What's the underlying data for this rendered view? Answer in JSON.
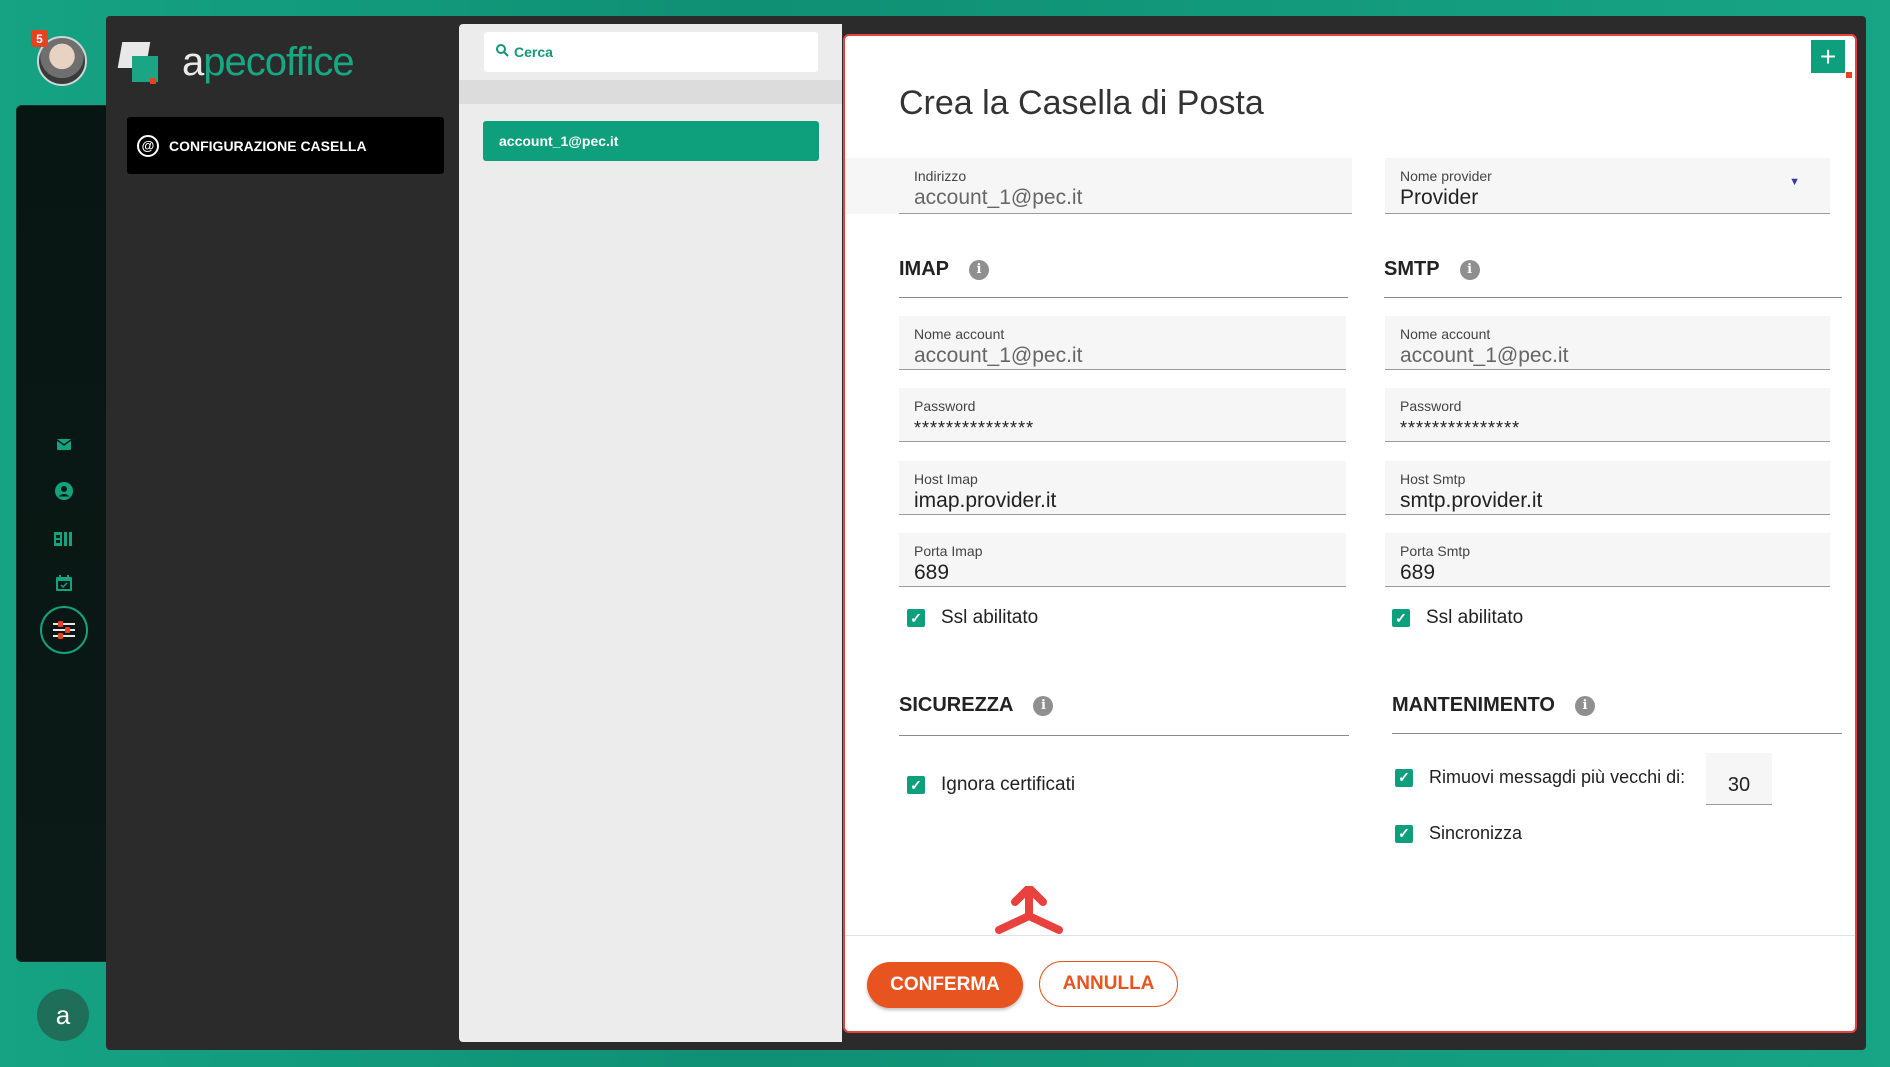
{
  "rail": {
    "badge_count": "5",
    "icons": [
      "mail-icon",
      "account-icon",
      "contacts-icon",
      "calendar-icon",
      "settings-sliders-icon"
    ],
    "bottom_logo": "a"
  },
  "brand": {
    "prefix": "a",
    "name": "pecoffice"
  },
  "nav": {
    "configurazione": "CONFIGURAZIONE CASELLA"
  },
  "search": {
    "placeholder": "Cerca"
  },
  "accounts": [
    {
      "label": "account_1@pec.it"
    }
  ],
  "form": {
    "title": "Crea la Casella di Posta",
    "indirizzo": {
      "label": "Indirizzo",
      "value": "account_1@pec.it"
    },
    "provider": {
      "label": "Nome provider",
      "value": "Provider"
    },
    "imap": {
      "heading": "IMAP",
      "account": {
        "label": "Nome account",
        "value": "account_1@pec.it"
      },
      "password": {
        "label": "Password",
        "value": "***************"
      },
      "host": {
        "label": "Host Imap",
        "value": "imap.provider.it"
      },
      "port": {
        "label": "Porta Imap",
        "value": "689"
      },
      "ssl": "Ssl abilitato"
    },
    "smtp": {
      "heading": "SMTP",
      "account": {
        "label": "Nome account",
        "value": "account_1@pec.it"
      },
      "password": {
        "label": "Password",
        "value": "***************"
      },
      "host": {
        "label": "Host Smtp",
        "value": "smtp.provider.it"
      },
      "port": {
        "label": "Porta Smtp",
        "value": "689"
      },
      "ssl": "Ssl abilitato"
    },
    "sicurezza": {
      "heading": "SICUREZZA",
      "ignora": "Ignora certificati"
    },
    "mantenimento": {
      "heading": "MANTENIMENTO",
      "rimuovi": "Rimuovi messagdi più vecchi di:",
      "days": "30",
      "sincronizza": "Sincronizza"
    },
    "confirm": "CONFERMA",
    "cancel": "ANNULLA"
  },
  "colors": {
    "accent": "#0e9f7c",
    "action": "#e8541f",
    "highlight_border": "#e8413e"
  }
}
